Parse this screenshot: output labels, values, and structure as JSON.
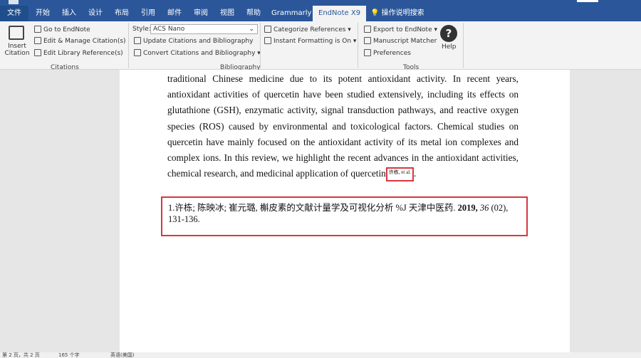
{
  "tabs": [
    "文件",
    "开始",
    "插入",
    "设计",
    "布局",
    "引用",
    "邮件",
    "审阅",
    "视图",
    "帮助",
    "Grammarly",
    "EndNote X9"
  ],
  "search": "操作说明搜索",
  "ribbon": {
    "insert_citation": "Insert Citation",
    "go_to_endnote": "Go to EndNote",
    "edit_manage": "Edit & Manage Citation(s)",
    "edit_library": "Edit Library Reference(s)",
    "citations_group": "Citations",
    "style_label": "Style:",
    "style_value": "ACS Nano",
    "update": "Update Citations and Bibliography",
    "convert": "Convert Citations and Bibliography",
    "categorize": "Categorize References",
    "instant": "Instant Formatting is On",
    "bibliography_group": "Bibliography",
    "export": "Export to EndNote",
    "matcher": "Manuscript Matcher",
    "preferences": "Preferences",
    "tools_group": "Tools",
    "help": "Help"
  },
  "document": {
    "paragraph": "traditional Chinese medicine due to its potent antioxidant activity. In recent years, antioxidant activities of quercetin have been studied extensively, including its effects on glutathione (GSH), enzymatic activity, signal transduction pathways, and reactive oxygen species (ROS) caused by environmental and toxicological factors. Chemical studies on quercetin have mainly focused on the antioxidant activity of its metal ion complexes and complex ions. In this review, we highlight the recent advances in the antioxidant activities, chemical research, and medicinal application of quercetin",
    "citation": "许栋, et al.",
    "bib_prefix": "1.许栋; 陈映冰; 崔元璐, 槲皮素的文献计量学及可视化分析 %J 天津中医药. ",
    "bib_year": "2019,",
    "bib_volume": "36",
    "bib_rest": " (02), 131-136."
  },
  "status": {
    "page": "第 2 页，共 2 页",
    "words": "165 个字",
    "lang": "英语(美国)"
  }
}
